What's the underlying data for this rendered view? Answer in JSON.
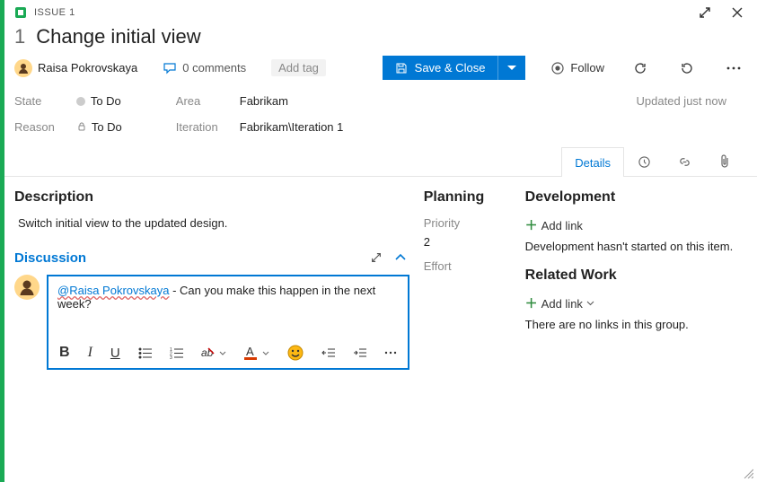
{
  "header": {
    "type_label": "ISSUE 1",
    "number": "1",
    "title": "Change initial view"
  },
  "assignee": {
    "name": "Raisa Pokrovskaya"
  },
  "comments": {
    "count_label": "0 comments"
  },
  "tags": {
    "add_label": "Add tag"
  },
  "actions": {
    "save_label": "Save & Close",
    "follow_label": "Follow"
  },
  "meta": {
    "state_label": "State",
    "state_value": "To Do",
    "reason_label": "Reason",
    "reason_value": "To Do",
    "area_label": "Area",
    "area_value": "Fabrikam",
    "iteration_label": "Iteration",
    "iteration_value": "Fabrikam\\Iteration 1",
    "updated_label": "Updated just now"
  },
  "tabs": {
    "details": "Details"
  },
  "description": {
    "heading": "Description",
    "text": "Switch initial view to the updated design."
  },
  "discussion": {
    "heading": "Discussion",
    "mention": "@Raisa Pokrovskaya",
    "text": " - Can you make this happen in the next week?"
  },
  "planning": {
    "heading": "Planning",
    "priority_label": "Priority",
    "priority_value": "2",
    "effort_label": "Effort"
  },
  "development": {
    "heading": "Development",
    "add_link": "Add link",
    "empty_text": "Development hasn't started on this item."
  },
  "related": {
    "heading": "Related Work",
    "add_link": "Add link",
    "empty_text": "There are no links in this group."
  }
}
